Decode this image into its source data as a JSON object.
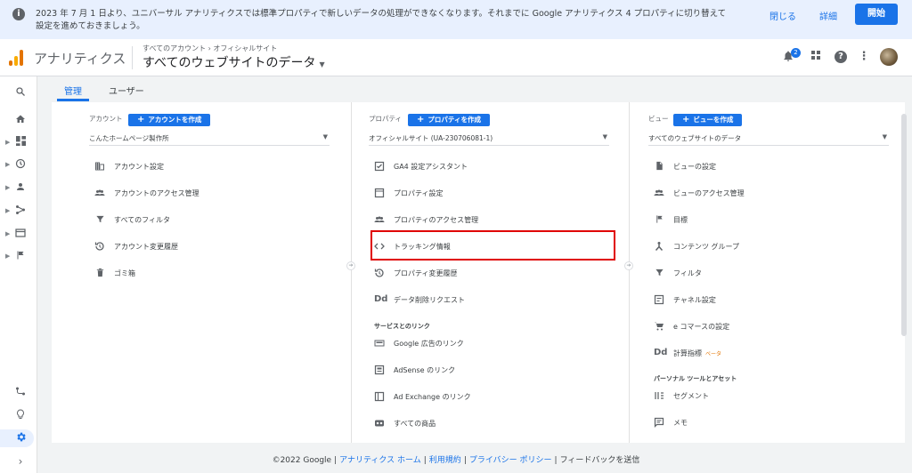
{
  "banner": {
    "text": "2023 年 7 月 1 日より、ユニバーサル アナリティクスでは標準プロパティで新しいデータの処理ができなくなります。それまでに Google アナリティクス 4 プロパティに切り替えて設定を進めておきましょう。",
    "close_label": "閉じる",
    "detail_label": "詳細",
    "start_label": "開始"
  },
  "header": {
    "app_name": "アナリティクス",
    "breadcrumb": "すべてのアカウント › オフィシャルサイト",
    "view_name": "すべてのウェブサイトのデータ",
    "notification_count": "2"
  },
  "tabs": {
    "admin": "管理",
    "user": "ユーザー"
  },
  "account": {
    "header": "アカウント",
    "create_label": "アカウントを作成",
    "selected": "こんたホームページ製作所",
    "items": [
      {
        "label": "アカウント設定"
      },
      {
        "label": "アカウントのアクセス管理"
      },
      {
        "label": "すべてのフィルタ"
      },
      {
        "label": "アカウント変更履歴"
      },
      {
        "label": "ゴミ箱"
      }
    ]
  },
  "property": {
    "header": "プロパティ",
    "create_label": "プロパティを作成",
    "selected": "オフィシャルサイト (UA-230706081-1)",
    "items": [
      {
        "label": "GA4 設定アシスタント"
      },
      {
        "label": "プロパティ設定"
      },
      {
        "label": "プロパティのアクセス管理"
      },
      {
        "label": "トラッキング情報"
      },
      {
        "label": "プロパティ変更履歴"
      },
      {
        "label": "データ削除リクエスト",
        "icon": "Dd"
      }
    ],
    "section_label": "サービスとのリンク",
    "link_items": [
      {
        "label": "Google 広告のリンク"
      },
      {
        "label": "AdSense のリンク"
      },
      {
        "label": "Ad Exchange のリンク"
      },
      {
        "label": "すべての商品"
      }
    ]
  },
  "view": {
    "header": "ビュー",
    "create_label": "ビューを作成",
    "selected": "すべてのウェブサイトのデータ",
    "items": [
      {
        "label": "ビューの設定"
      },
      {
        "label": "ビューのアクセス管理"
      },
      {
        "label": "目標"
      },
      {
        "label": "コンテンツ グループ"
      },
      {
        "label": "フィルタ"
      },
      {
        "label": "チャネル設定"
      },
      {
        "label": "e コマースの設定"
      },
      {
        "label": "計算指標",
        "beta": "ベータ",
        "icon": "Dd"
      }
    ],
    "section_label": "パーソナル ツールとアセット",
    "tool_items": [
      {
        "label": "セグメント"
      },
      {
        "label": "メモ"
      }
    ]
  },
  "footer": {
    "copyright": "©2022 Google",
    "home": "アナリティクス ホーム",
    "terms": "利用規約",
    "privacy": "プライバシー ポリシー",
    "feedback": "フィードバックを送信"
  }
}
